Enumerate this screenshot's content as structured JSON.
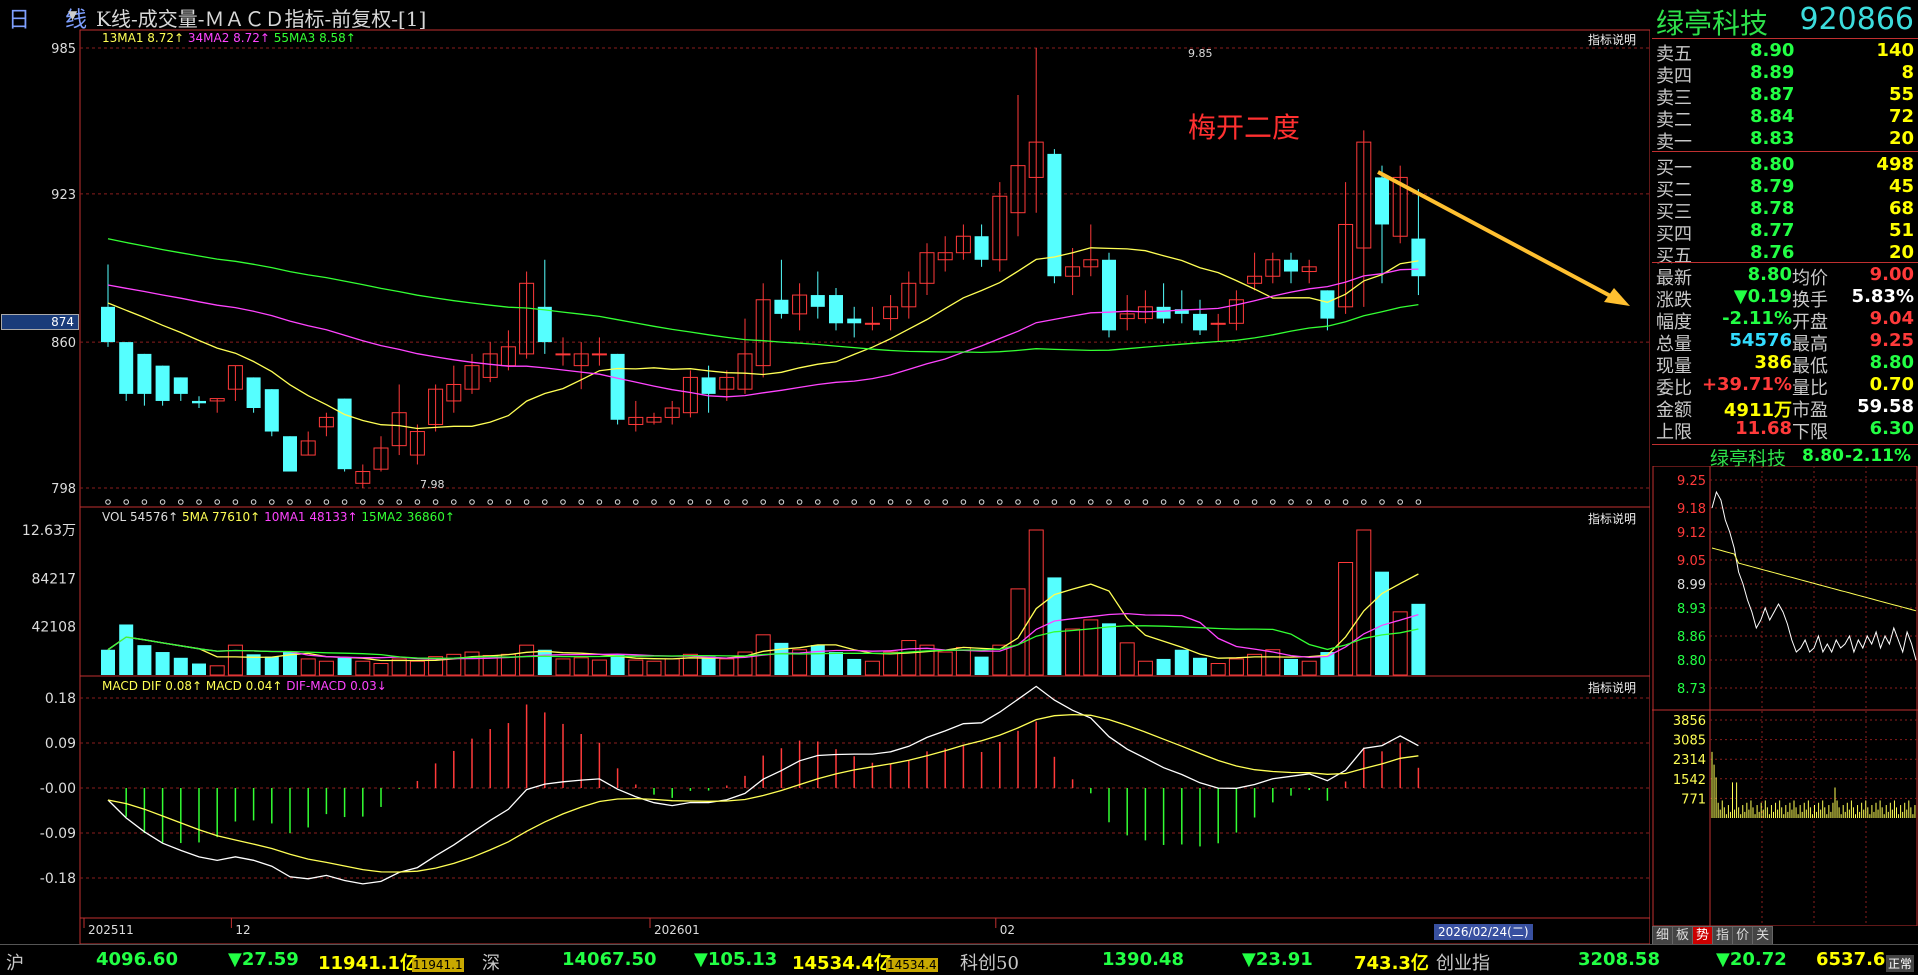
{
  "title_bar": {
    "period": "日 线",
    "title": "K线-成交量-ＭＡＣＤ指标-前复权-[1]"
  },
  "kline": {
    "legend": [
      {
        "text": "13MA1 8.72↑",
        "color": "#ffff55"
      },
      {
        "text": "34MA2 8.72↑",
        "color": "#ff44ff"
      },
      {
        "text": "55MA3 8.58↑",
        "color": "#33ff33"
      }
    ],
    "indicator_link": "指标说明",
    "y_ticks": [
      "985",
      "923",
      "860",
      "798"
    ],
    "current_price_tag": "874",
    "high_label": "9.85",
    "low_label": "7.98",
    "annotation": "梅开二度"
  },
  "volume": {
    "legend": [
      {
        "text": "VOL 54576↑",
        "color": "#dddddd"
      },
      {
        "text": "5MA 77610↑",
        "color": "#ffff55"
      },
      {
        "text": "10MA1 48133↑",
        "color": "#ff44ff"
      },
      {
        "text": "15MA2 36860↑",
        "color": "#33ff33"
      }
    ],
    "indicator_link": "指标说明",
    "y_ticks": [
      "12.63万",
      "84217",
      "42108"
    ]
  },
  "macd": {
    "legend": [
      {
        "text": "MACD DIF 0.08↑",
        "color": "#ffff55"
      },
      {
        "text": "MACD 0.04↑",
        "color": "#ffff55"
      },
      {
        "text": "DIF-MACD 0.03↓",
        "color": "#ff44ff"
      }
    ],
    "indicator_link": "指标说明",
    "y_ticks": [
      "0.18",
      "0.09",
      "-0.00",
      "-0.09",
      "-0.18"
    ]
  },
  "x_axis": {
    "labels": [
      "202511",
      "12",
      "202601",
      "02"
    ],
    "cursor_date": "2026/02/24(二)"
  },
  "stock": {
    "name": "绿亭科技",
    "code": "920866"
  },
  "order_book": {
    "sell": [
      {
        "label": "卖五",
        "price": "8.90",
        "vol": "140"
      },
      {
        "label": "卖四",
        "price": "8.89",
        "vol": "8"
      },
      {
        "label": "卖三",
        "price": "8.87",
        "vol": "55"
      },
      {
        "label": "卖二",
        "price": "8.84",
        "vol": "72"
      },
      {
        "label": "卖一",
        "price": "8.83",
        "vol": "20"
      }
    ],
    "buy": [
      {
        "label": "买一",
        "price": "8.80",
        "vol": "498"
      },
      {
        "label": "买二",
        "price": "8.79",
        "vol": "45"
      },
      {
        "label": "买三",
        "price": "8.78",
        "vol": "68"
      },
      {
        "label": "买四",
        "price": "8.77",
        "vol": "51"
      },
      {
        "label": "买五",
        "price": "8.76",
        "vol": "20"
      }
    ]
  },
  "quote": [
    {
      "l1": "最新",
      "v1": "8.80",
      "c1": "#22ff44",
      "l2": "均价",
      "v2": "9.00",
      "c2": "#ff3a3a"
    },
    {
      "l1": "涨跌",
      "v1": "▼0.19",
      "c1": "#22ff44",
      "l2": "换手",
      "v2": "5.83%",
      "c2": "#ffffff"
    },
    {
      "l1": "幅度",
      "v1": "-2.11%",
      "c1": "#22ff44",
      "l2": "开盘",
      "v2": "9.04",
      "c2": "#ff3a3a"
    },
    {
      "l1": "总量",
      "v1": "54576",
      "c1": "#33ddff",
      "l2": "最高",
      "v2": "9.25",
      "c2": "#ff3a3a"
    },
    {
      "l1": "现量",
      "v1": "386",
      "c1": "#ffff00",
      "l2": "最低",
      "v2": "8.80",
      "c2": "#22ff44"
    },
    {
      "l1": "委比",
      "v1": "+39.71%",
      "c1": "#ff3a3a",
      "l2": "量比",
      "v2": "0.70",
      "c2": "#ffff00"
    },
    {
      "l1": "金额",
      "v1": "4911万",
      "c1": "#ffff00",
      "l2": "市盈",
      "v2": "59.58",
      "c2": "#ffffff"
    },
    {
      "l1": "上限",
      "v1": "11.68",
      "c1": "#ff3a3a",
      "l2": "下限",
      "v2": "6.30",
      "c2": "#22ff44"
    }
  ],
  "intraday": {
    "name": "绿亭科技",
    "price": "8.80",
    "change": "-2.11%",
    "price_ticks": [
      "9.25",
      "9.18",
      "9.12",
      "9.05",
      "8.99",
      "8.93",
      "8.86",
      "8.80",
      "8.73"
    ],
    "vol_ticks": [
      "3856",
      "3085",
      "2314",
      "1542",
      "771"
    ]
  },
  "tabs": [
    "细",
    "板",
    "势",
    "指",
    "价",
    "关"
  ],
  "active_tab": "势",
  "bottom": {
    "sh_label": "沪",
    "sh_value": "4096.60",
    "sh_change": "▼27.59",
    "sh_amount": "11941.1亿",
    "sh_box": "11941.1",
    "sz_label": "深",
    "sz_value": "14067.50",
    "sz_change": "▼105.13",
    "sz_amount": "14534.4亿",
    "sz_box": "14534.4",
    "kc_label": "科创50",
    "kc_value": "1390.48",
    "kc_change": "▼23.91",
    "kc_amount": "743.3亿",
    "cy_label": "创业指",
    "cy_value": "3208.58",
    "cy_change": "▼20.72",
    "cy_amount": "6537.6",
    "status": "正常"
  },
  "chart_data": [
    {
      "type": "candlestick",
      "title": "K线",
      "ylim": [
        7.98,
        9.85
      ],
      "candles": [
        [
          8.75,
          8.6,
          8.93,
          8.58
        ],
        [
          8.6,
          8.38,
          8.6,
          8.35
        ],
        [
          8.55,
          8.38,
          8.55,
          8.33
        ],
        [
          8.5,
          8.35,
          8.5,
          8.33
        ],
        [
          8.45,
          8.38,
          8.45,
          8.35
        ],
        [
          8.35,
          8.34,
          8.37,
          8.32
        ],
        [
          8.35,
          8.36,
          8.36,
          8.3
        ],
        [
          8.4,
          8.5,
          8.5,
          8.35
        ],
        [
          8.45,
          8.32,
          8.45,
          8.3
        ],
        [
          8.4,
          8.22,
          8.4,
          8.2
        ],
        [
          8.2,
          8.05,
          8.2,
          8.05
        ],
        [
          8.12,
          8.18,
          8.22,
          8.12
        ],
        [
          8.24,
          8.28,
          8.3,
          8.2
        ],
        [
          8.36,
          8.06,
          8.36,
          8.05
        ],
        [
          8.0,
          8.05,
          8.08,
          7.98
        ],
        [
          8.06,
          8.15,
          8.2,
          8.05
        ],
        [
          8.16,
          8.3,
          8.42,
          8.12
        ],
        [
          8.12,
          8.22,
          8.25,
          8.08
        ],
        [
          8.25,
          8.4,
          8.42,
          8.22
        ],
        [
          8.35,
          8.42,
          8.5,
          8.3
        ],
        [
          8.4,
          8.5,
          8.55,
          8.38
        ],
        [
          8.45,
          8.55,
          8.6,
          8.43
        ],
        [
          8.5,
          8.58,
          8.65,
          8.48
        ],
        [
          8.55,
          8.85,
          8.9,
          8.53
        ],
        [
          8.75,
          8.6,
          8.95,
          8.55
        ],
        [
          8.55,
          8.55,
          8.62,
          8.5
        ],
        [
          8.5,
          8.55,
          8.6,
          8.4
        ],
        [
          8.55,
          8.55,
          8.62,
          8.5
        ],
        [
          8.55,
          8.27,
          8.55,
          8.25
        ],
        [
          8.25,
          8.28,
          8.35,
          8.22
        ],
        [
          8.26,
          8.28,
          8.3,
          8.25
        ],
        [
          8.28,
          8.32,
          8.35,
          8.25
        ],
        [
          8.3,
          8.45,
          8.48,
          8.28
        ],
        [
          8.45,
          8.38,
          8.5,
          8.3
        ],
        [
          8.4,
          8.45,
          8.48,
          8.35
        ],
        [
          8.4,
          8.55,
          8.7,
          8.38
        ],
        [
          8.5,
          8.78,
          8.85,
          8.45
        ],
        [
          8.78,
          8.72,
          8.95,
          8.7
        ],
        [
          8.72,
          8.8,
          8.85,
          8.65
        ],
        [
          8.8,
          8.75,
          8.9,
          8.7
        ],
        [
          8.8,
          8.68,
          8.83,
          8.65
        ],
        [
          8.7,
          8.68,
          8.75,
          8.62
        ],
        [
          8.68,
          8.68,
          8.75,
          8.65
        ],
        [
          8.7,
          8.75,
          8.8,
          8.65
        ],
        [
          8.75,
          8.85,
          8.9,
          8.7
        ],
        [
          8.85,
          8.98,
          9.02,
          8.8
        ],
        [
          8.95,
          8.98,
          9.05,
          8.9
        ],
        [
          8.98,
          9.05,
          9.1,
          8.95
        ],
        [
          9.05,
          8.95,
          9.1,
          8.92
        ],
        [
          8.95,
          9.22,
          9.28,
          8.9
        ],
        [
          9.15,
          9.35,
          9.65,
          9.05
        ],
        [
          9.3,
          9.45,
          9.85,
          9.15
        ],
        [
          9.4,
          8.88,
          9.42,
          8.85
        ],
        [
          8.88,
          8.92,
          9.0,
          8.8
        ],
        [
          8.92,
          8.95,
          9.1,
          8.88
        ],
        [
          8.95,
          8.65,
          8.98,
          8.62
        ],
        [
          8.7,
          8.72,
          8.8,
          8.65
        ],
        [
          8.7,
          8.75,
          8.82,
          8.68
        ],
        [
          8.75,
          8.7,
          8.85,
          8.68
        ],
        [
          8.74,
          8.72,
          8.82,
          8.68
        ],
        [
          8.72,
          8.65,
          8.78,
          8.63
        ],
        [
          8.68,
          8.68,
          8.72,
          8.6
        ],
        [
          8.68,
          8.78,
          8.82,
          8.65
        ],
        [
          8.85,
          8.88,
          8.98,
          8.82
        ],
        [
          8.88,
          8.95,
          8.98,
          8.85
        ],
        [
          8.95,
          8.9,
          8.98,
          8.85
        ],
        [
          8.9,
          8.92,
          8.95,
          8.85
        ],
        [
          8.82,
          8.7,
          8.82,
          8.65
        ],
        [
          8.75,
          9.1,
          9.28,
          8.72
        ],
        [
          9.0,
          9.45,
          9.5,
          8.75
        ],
        [
          9.3,
          9.1,
          9.35,
          8.85
        ],
        [
          9.05,
          9.3,
          9.35,
          9.02
        ],
        [
          9.04,
          8.88,
          9.25,
          8.8
        ]
      ],
      "ma_points_desc": "13MA1, 34MA2, 55MA3 moving averages"
    }
  ]
}
